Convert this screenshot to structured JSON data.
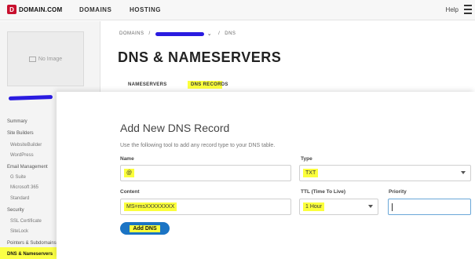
{
  "brand": {
    "name": "DOMAIN.COM",
    "mark": "D"
  },
  "topnav": {
    "domains": "DOMAINS",
    "hosting": "HOSTING",
    "help": "Help"
  },
  "sidebar": {
    "thumbnail_text": "No Image",
    "items": [
      {
        "label": "Summary",
        "level": 0
      },
      {
        "label": "Site Builders",
        "level": 0
      },
      {
        "label": "WebsiteBuilder",
        "level": 1
      },
      {
        "label": "WordPress",
        "level": 1
      },
      {
        "label": "Email Management",
        "level": 0
      },
      {
        "label": "G Suite",
        "level": 1
      },
      {
        "label": "Microsoft 365",
        "level": 1
      },
      {
        "label": "Standard",
        "level": 1
      },
      {
        "label": "Security",
        "level": 0
      },
      {
        "label": "SSL Certificate",
        "level": 1
      },
      {
        "label": "SiteLock",
        "level": 1
      },
      {
        "label": "Pointers & Subdomains",
        "level": 0
      },
      {
        "label": "DNS & Nameservers",
        "level": 0
      }
    ]
  },
  "breadcrumb": {
    "root": "DOMAINS",
    "separator": "/",
    "current": "DNS"
  },
  "page": {
    "title": "DNS & NAMESERVERS"
  },
  "tabs": {
    "nameservers": "NAMESERVERS",
    "dns_records": "DNS RECORDS"
  },
  "modal": {
    "title": "Add New DNS Record",
    "description": "Use the following tool to add any record type to your DNS table.",
    "name_label": "Name",
    "name_value": "@",
    "type_label": "Type",
    "type_value": "TXT",
    "content_label": "Content",
    "content_value": "MS=msXXXXXXXX",
    "ttl_label": "TTL (Time To Live)",
    "ttl_value": "1 Hour",
    "priority_label": "Priority",
    "priority_value": "",
    "submit_label": "Add DNS"
  },
  "colors": {
    "brand_red": "#c8102e",
    "button_blue": "#1b74c4",
    "highlight": "#fbff3c",
    "redaction": "#2a1be0"
  }
}
